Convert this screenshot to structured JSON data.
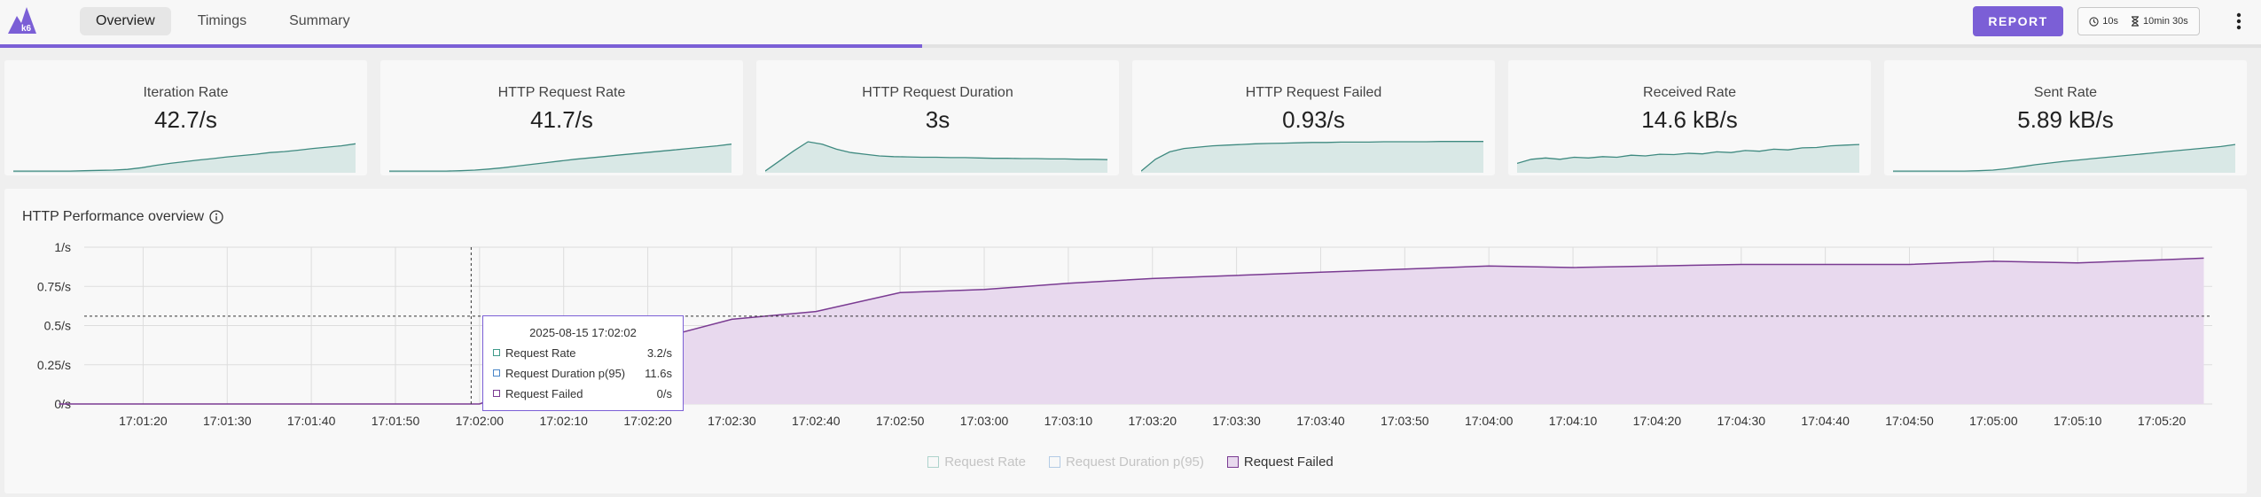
{
  "app": {
    "logo_icon": "k6-logo",
    "logo_text": "k6",
    "accent_color": "#7b5fd6",
    "progress": 0.408
  },
  "tabs": [
    {
      "label": "Overview",
      "active": true
    },
    {
      "label": "Timings",
      "active": false
    },
    {
      "label": "Summary",
      "active": false
    }
  ],
  "toolbar": {
    "report_label": "REPORT",
    "period_icon": "clock-icon",
    "period": "10s",
    "duration_icon": "hourglass-icon",
    "duration": "10min 30s",
    "menu_icon": "more-vertical-icon"
  },
  "cards": [
    {
      "title": "Iteration Rate",
      "value": "42.7/s",
      "spark": [
        0.05,
        0.05,
        0.05,
        0.05,
        0.05,
        0.06,
        0.07,
        0.08,
        0.1,
        0.15,
        0.22,
        0.28,
        0.33,
        0.38,
        0.42,
        0.47,
        0.51,
        0.55,
        0.6,
        0.63,
        0.67,
        0.72,
        0.76,
        0.8,
        0.86
      ]
    },
    {
      "title": "HTTP Request Rate",
      "value": "41.7/s",
      "spark": [
        0.05,
        0.05,
        0.05,
        0.05,
        0.05,
        0.06,
        0.08,
        0.11,
        0.15,
        0.2,
        0.25,
        0.3,
        0.35,
        0.4,
        0.44,
        0.48,
        0.52,
        0.56,
        0.6,
        0.64,
        0.68,
        0.72,
        0.76,
        0.8,
        0.85
      ]
    },
    {
      "title": "HTTP Request Duration",
      "value": "3s",
      "spark": [
        0.05,
        0.35,
        0.65,
        0.92,
        0.85,
        0.7,
        0.6,
        0.55,
        0.5,
        0.48,
        0.47,
        0.46,
        0.46,
        0.45,
        0.45,
        0.44,
        0.43,
        0.43,
        0.42,
        0.42,
        0.41,
        0.41,
        0.4,
        0.4,
        0.39
      ]
    },
    {
      "title": "HTTP Request Failed",
      "value": "0.93/s",
      "spark": [
        0.05,
        0.4,
        0.62,
        0.72,
        0.76,
        0.8,
        0.82,
        0.84,
        0.86,
        0.87,
        0.88,
        0.89,
        0.9,
        0.9,
        0.91,
        0.91,
        0.91,
        0.92,
        0.92,
        0.92,
        0.92,
        0.93,
        0.93,
        0.93,
        0.93
      ]
    },
    {
      "title": "Received Rate",
      "value": "14.6 kB/s",
      "spark": [
        0.28,
        0.4,
        0.44,
        0.4,
        0.46,
        0.44,
        0.48,
        0.46,
        0.52,
        0.5,
        0.55,
        0.54,
        0.58,
        0.56,
        0.62,
        0.6,
        0.66,
        0.64,
        0.7,
        0.68,
        0.74,
        0.75,
        0.8,
        0.82,
        0.84
      ]
    },
    {
      "title": "Sent Rate",
      "value": "5.89 kB/s",
      "spark": [
        0.05,
        0.05,
        0.05,
        0.05,
        0.05,
        0.05,
        0.06,
        0.08,
        0.12,
        0.18,
        0.24,
        0.29,
        0.34,
        0.38,
        0.42,
        0.46,
        0.5,
        0.54,
        0.58,
        0.62,
        0.66,
        0.7,
        0.74,
        0.78,
        0.84
      ]
    }
  ],
  "panel": {
    "title": "HTTP Performance overview",
    "info_icon": "info-icon"
  },
  "chart_data": {
    "type": "area",
    "y_ticks": [
      "0/s",
      "0.25/s",
      "0.5/s",
      "0.75/s",
      "1/s"
    ],
    "ylim": [
      0,
      1
    ],
    "x_ticks": [
      "17:01:20",
      "17:01:30",
      "17:01:40",
      "17:01:50",
      "17:02:00",
      "17:02:10",
      "17:02:20",
      "17:02:30",
      "17:02:40",
      "17:02:50",
      "17:03:00",
      "17:03:10",
      "17:03:20",
      "17:03:30",
      "17:03:40",
      "17:03:50",
      "17:04:00",
      "17:04:10",
      "17:04:20",
      "17:04:30",
      "17:04:40",
      "17:04:50",
      "17:05:00",
      "17:05:10",
      "17:05:20"
    ],
    "series": [
      {
        "name": "Request Rate",
        "color": "#3f9a8a",
        "visible": false
      },
      {
        "name": "Request Duration p(95)",
        "color": "#4a86c8",
        "visible": false
      },
      {
        "name": "Request Failed",
        "color": "#7a3b92",
        "visible": true,
        "x": [
          "17:01:10",
          "17:01:20",
          "17:01:30",
          "17:01:40",
          "17:01:50",
          "17:02:00",
          "17:02:10",
          "17:02:20",
          "17:02:30",
          "17:02:40",
          "17:02:50",
          "17:03:00",
          "17:03:10",
          "17:03:20",
          "17:03:30",
          "17:03:40",
          "17:03:50",
          "17:04:00",
          "17:04:10",
          "17:04:20",
          "17:04:30",
          "17:04:40",
          "17:04:50",
          "17:05:00",
          "17:05:10",
          "17:05:20",
          "17:05:25"
        ],
        "values": [
          0,
          0,
          0,
          0,
          0,
          0,
          0.2,
          0.4,
          0.54,
          0.59,
          0.71,
          0.73,
          0.77,
          0.8,
          0.82,
          0.84,
          0.86,
          0.88,
          0.87,
          0.88,
          0.89,
          0.89,
          0.89,
          0.91,
          0.9,
          0.92,
          0.93
        ]
      }
    ],
    "crosshair_x": "17:01:59",
    "crosshair_y": 0.56,
    "legend_position": "bottom"
  },
  "tooltip": {
    "title": "2025-08-15 17:02:02",
    "rows": [
      {
        "label": "Request Rate",
        "value": "3.2/s",
        "color": "#3f9a8a"
      },
      {
        "label": "Request Duration p(95)",
        "value": "11.6s",
        "color": "#4a86c8"
      },
      {
        "label": "Request Failed",
        "value": "0/s",
        "color": "#7a3b92"
      }
    ]
  }
}
